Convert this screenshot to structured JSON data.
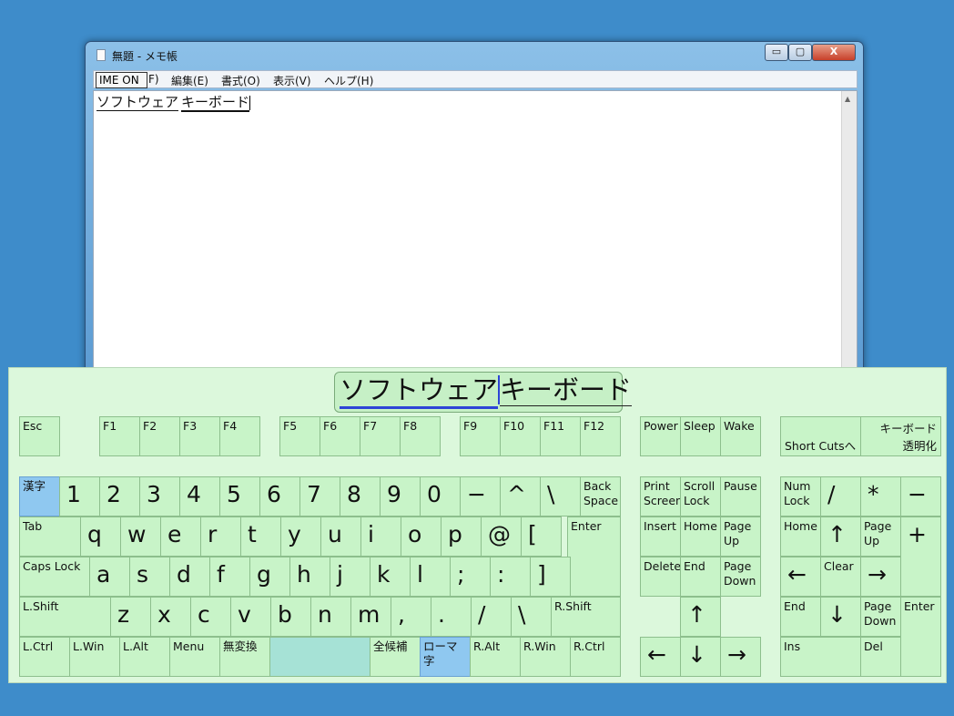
{
  "window": {
    "title": "無題 - メモ帳",
    "controls": {
      "min": "▭",
      "max": "▢",
      "close": "X"
    },
    "ime_button": "IME ON",
    "menu": [
      "F)",
      "編集(E)",
      "書式(O)",
      "表示(V)",
      "ヘルプ(H)"
    ],
    "content": {
      "seg1": "ソフトウェア",
      "seg2": "キーボード"
    }
  },
  "keyboard": {
    "composition": {
      "seg1": "ソフトウェア",
      "seg2": "キーボード"
    },
    "accent_color": "#8fc8f0",
    "keys": {
      "esc": "Esc",
      "f1": "F1",
      "f2": "F2",
      "f3": "F3",
      "f4": "F4",
      "f5": "F5",
      "f6": "F6",
      "f7": "F7",
      "f8": "F8",
      "f9": "F9",
      "f10": "F10",
      "f11": "F11",
      "f12": "F12",
      "power": "Power",
      "sleep": "Sleep",
      "wake": "Wake",
      "shortcuts": "Short Cutsへ",
      "kbd_top": "キーボード",
      "kbd_bottom": "透明化",
      "kanji": "漢字",
      "n1": "1",
      "n2": "2",
      "n3": "3",
      "n4": "4",
      "n5": "5",
      "n6": "6",
      "n7": "7",
      "n8": "8",
      "n9": "9",
      "n0": "0",
      "minus": "−",
      "caret": "^",
      "yen": "\\",
      "backspace": "Back\nSpace",
      "printscreen": "Print\nScreen",
      "scrolllock": "Scroll\nLock",
      "pause": "Pause",
      "numlock": "Num\nLock",
      "np_div": "/",
      "np_mul": "*",
      "np_sub": "−",
      "tab": "Tab",
      "q": "q",
      "w": "w",
      "e": "e",
      "r": "r",
      "t": "t",
      "y": "y",
      "u": "u",
      "i": "i",
      "o": "o",
      "p": "p",
      "at": "@",
      "lbracket": "[",
      "enter": "Enter",
      "insert": "Insert",
      "home": "Home",
      "pageup": "Page\nUp",
      "np_home": "Home",
      "np_up": "↑",
      "np_pgup": "Page\nUp",
      "np_add": "+",
      "capslock": "Caps Lock",
      "a": "a",
      "s": "s",
      "d": "d",
      "f": "f",
      "g": "g",
      "h": "h",
      "j": "j",
      "k": "k",
      "l": "l",
      "semicolon": ";",
      "colon": ":",
      "rbracket": "]",
      "delete": "Delete",
      "end": "End",
      "pagedown": "Page\nDown",
      "np_left": "←",
      "np_clear": "Clear",
      "np_right": "→",
      "lshift": "L.Shift",
      "z": "z",
      "x": "x",
      "c": "c",
      "v": "v",
      "b": "b",
      "n": "n",
      "m": "m",
      "comma": ",",
      "period": ".",
      "slash": "/",
      "backslash": "\\",
      "rshift": "R.Shift",
      "arrow_up": "↑",
      "np_end": "End",
      "np_down": "↓",
      "np_pgdn": "Page\nDown",
      "np_enter": "Enter",
      "lctrl": "L.Ctrl",
      "lwin": "L.Win",
      "lalt": "L.Alt",
      "menu": "Menu",
      "muhenkan": "無変換",
      "space": "",
      "zenkoho": "全候補",
      "roma": "ローマ\n字",
      "ralt": "R.Alt",
      "rwin": "R.Win",
      "rctrl": "R.Ctrl",
      "arrow_left": "←",
      "arrow_down": "↓",
      "arrow_right": "→",
      "np_ins": "Ins",
      "np_del": "Del"
    }
  }
}
